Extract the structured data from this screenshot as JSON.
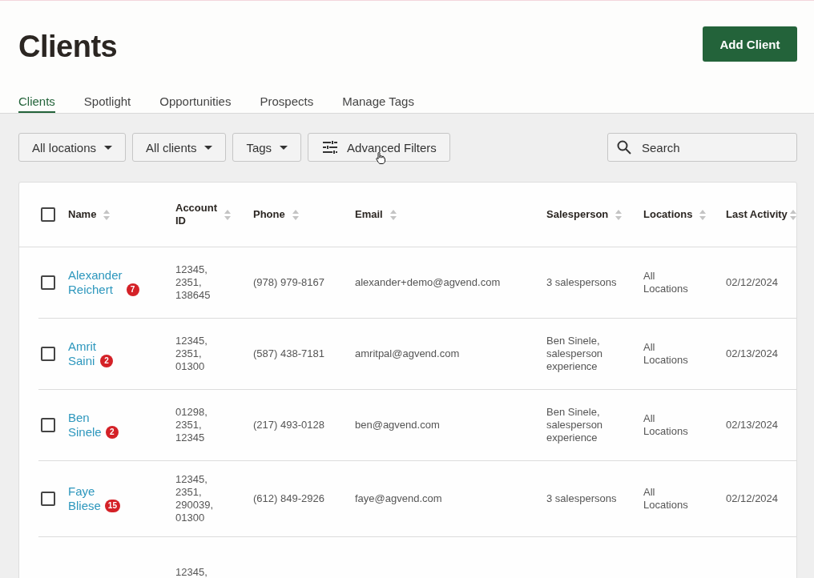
{
  "page": {
    "title": "Clients",
    "add_button": "Add Client"
  },
  "tabs": [
    {
      "label": "Clients",
      "selected": true
    },
    {
      "label": "Spotlight",
      "selected": false
    },
    {
      "label": "Opportunities",
      "selected": false
    },
    {
      "label": "Prospects",
      "selected": false
    },
    {
      "label": "Manage Tags",
      "selected": false
    }
  ],
  "filters": [
    {
      "label": "All locations",
      "kind": "dropdown"
    },
    {
      "label": "All clients",
      "kind": "dropdown"
    },
    {
      "label": "Tags",
      "kind": "dropdown"
    },
    {
      "label": "Advanced Filters",
      "kind": "advanced"
    }
  ],
  "search": {
    "placeholder": "Search"
  },
  "table": {
    "select_all_checked": false,
    "columns": [
      "Name",
      "Account ID",
      "Phone",
      "Email",
      "Salesperson",
      "Locations",
      "Last Activity"
    ],
    "rows": [
      {
        "checked": false,
        "first_name": "Alexander",
        "last_name": "Reichert",
        "tag_count": "7",
        "account_id": "12345, 2351, 138645",
        "phone": "(978) 979-8167",
        "email": "alexander+demo@agvend.com",
        "salesperson": "3 salespersons",
        "locations": "All Locations",
        "last_activity": "02/12/2024"
      },
      {
        "checked": false,
        "first_name": "Amrit",
        "last_name": "Saini",
        "tag_count": "2",
        "account_id": "12345, 2351, 01300",
        "phone": "(587) 438-7181",
        "email": "amritpal@agvend.com",
        "salesperson": "Ben Sinele, salesperson experience",
        "locations": "All Locations",
        "last_activity": "02/13/2024"
      },
      {
        "checked": false,
        "first_name": "Ben",
        "last_name": "Sinele",
        "tag_count": "2",
        "account_id": "01298, 2351, 12345",
        "phone": "(217) 493-0128",
        "email": "ben@agvend.com",
        "salesperson": "Ben Sinele, salesperson experience",
        "locations": "All Locations",
        "last_activity": "02/13/2024"
      },
      {
        "checked": false,
        "first_name": "Faye",
        "last_name": "Bliese",
        "tag_count": "15",
        "account_id": "12345, 2351, 290039, 01300",
        "phone": "(612) 849-2926",
        "email": "faye@agvend.com",
        "salesperson": "3 salespersons",
        "locations": "All Locations",
        "last_activity": "02/12/2024"
      },
      {
        "account_id": "12345,"
      }
    ]
  }
}
